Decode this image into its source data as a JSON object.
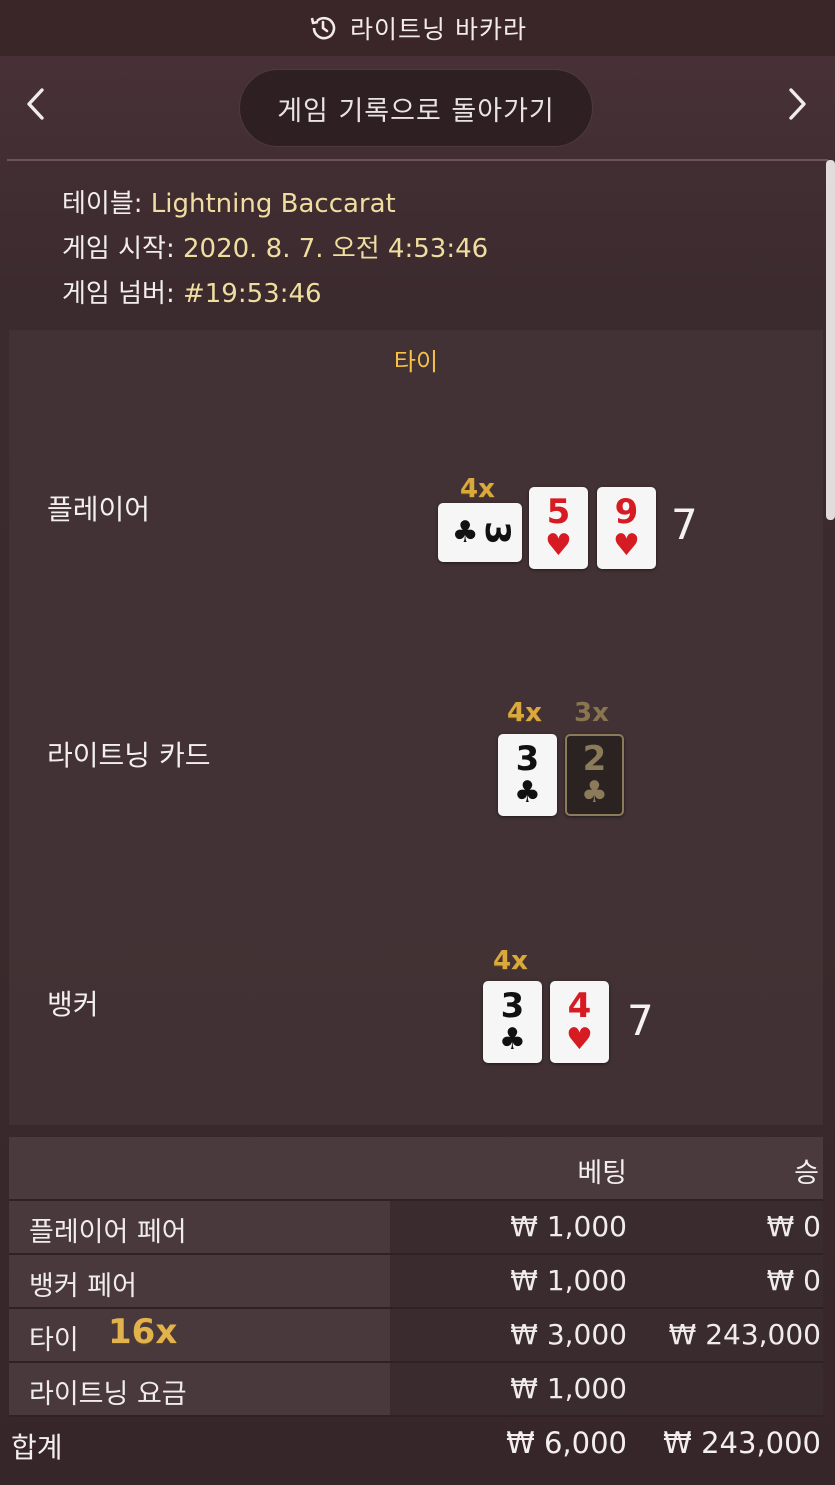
{
  "header": {
    "title": "라이트닝 바카라",
    "back_label": "게임 기록으로 돌아가기"
  },
  "info": {
    "table_label": "테이블:",
    "table_value": "Lightning Baccarat",
    "start_label": "게임 시작:",
    "start_value": "2020. 8. 7. 오전 4:53:46",
    "number_label": "게임 넘버:",
    "number_value": "#19:53:46"
  },
  "result": "타이",
  "player": {
    "label": "플레이어",
    "score": "7",
    "cards": [
      {
        "rank": "3",
        "suit": "♣",
        "color": "black",
        "multiplier": "4x"
      },
      {
        "rank": "5",
        "suit": "♥",
        "color": "red"
      },
      {
        "rank": "9",
        "suit": "♥",
        "color": "red"
      }
    ]
  },
  "lightning": {
    "label": "라이트닝 카드",
    "cards": [
      {
        "rank": "3",
        "suit": "♣",
        "color": "black",
        "multiplier": "4x"
      },
      {
        "rank": "2",
        "suit": "♣",
        "color": "dark",
        "multiplier": "3x"
      }
    ]
  },
  "banker": {
    "label": "뱅커",
    "score": "7",
    "cards": [
      {
        "rank": "3",
        "suit": "♣",
        "color": "black",
        "multiplier": "4x"
      },
      {
        "rank": "4",
        "suit": "♥",
        "color": "red"
      }
    ]
  },
  "bets": {
    "col_bet": "베팅",
    "col_win": "승",
    "rows": [
      {
        "label": "플레이어 페어",
        "bet": "₩ 1,000",
        "win": "₩ 0"
      },
      {
        "label": "뱅커 페어",
        "bet": "₩ 1,000",
        "win": "₩ 0"
      },
      {
        "label": "타이",
        "multiplier": "16x",
        "bet": "₩ 3,000",
        "win": "₩ 243,000"
      },
      {
        "label": "라이트닝 요금",
        "bet": "₩ 1,000",
        "win": ""
      }
    ],
    "total": {
      "label": "합계",
      "bet": "₩ 6,000",
      "win": "₩ 243,000"
    }
  }
}
